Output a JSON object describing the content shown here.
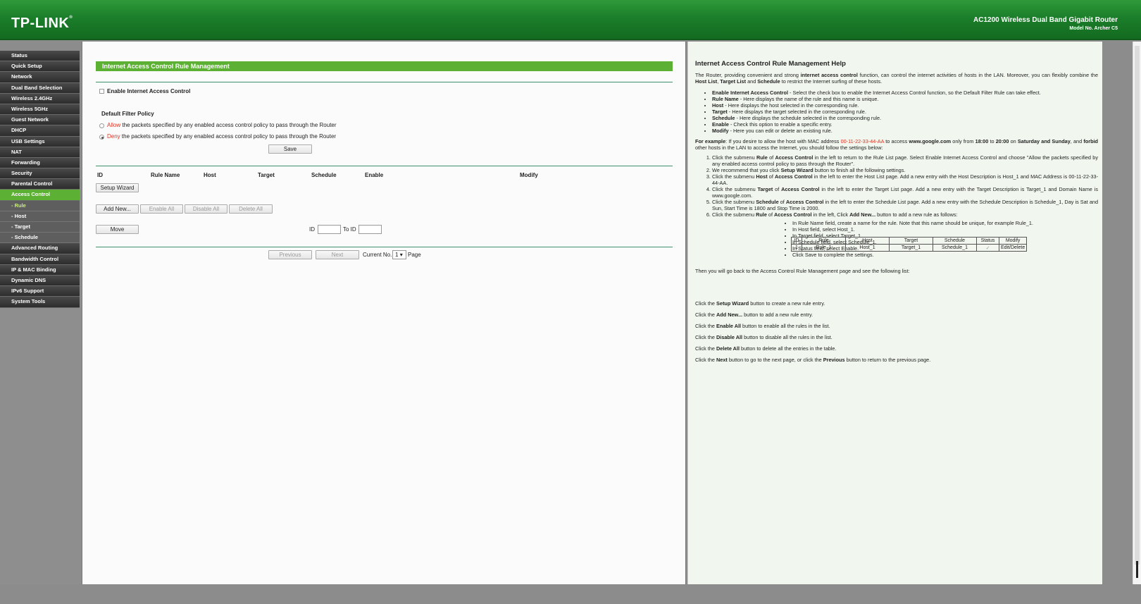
{
  "header": {
    "brand": "TP-LINK",
    "product_name": "AC1200 Wireless Dual Band Gigabit Router",
    "model": "Model No. Archer C5"
  },
  "sidebar": {
    "items": [
      {
        "label": "Status",
        "type": "item"
      },
      {
        "label": "Quick Setup",
        "type": "item"
      },
      {
        "label": "Network",
        "type": "item"
      },
      {
        "label": "Dual Band Selection",
        "type": "item"
      },
      {
        "label": "Wireless 2.4GHz",
        "type": "item"
      },
      {
        "label": "Wireless 5GHz",
        "type": "item"
      },
      {
        "label": "Guest Network",
        "type": "item"
      },
      {
        "label": "DHCP",
        "type": "item"
      },
      {
        "label": "USB Settings",
        "type": "item"
      },
      {
        "label": "NAT",
        "type": "item"
      },
      {
        "label": "Forwarding",
        "type": "item"
      },
      {
        "label": "Security",
        "type": "item"
      },
      {
        "label": "Parental Control",
        "type": "item"
      },
      {
        "label": "Access Control",
        "type": "item",
        "active": true
      },
      {
        "label": "- Rule",
        "type": "sub",
        "active": true
      },
      {
        "label": "- Host",
        "type": "sub"
      },
      {
        "label": "- Target",
        "type": "sub"
      },
      {
        "label": "- Schedule",
        "type": "sub"
      },
      {
        "label": "Advanced Routing",
        "type": "item"
      },
      {
        "label": "Bandwidth Control",
        "type": "item"
      },
      {
        "label": "IP & MAC Binding",
        "type": "item"
      },
      {
        "label": "Dynamic DNS",
        "type": "item"
      },
      {
        "label": "IPv6 Support",
        "type": "item"
      },
      {
        "label": "System Tools",
        "type": "item"
      }
    ]
  },
  "main": {
    "title": "Internet Access Control Rule Management",
    "enable_label": "Enable Internet Access Control",
    "policy_title": "Default Filter Policy",
    "allow_word": "Allow",
    "allow_rest": " the packets specified by any enabled access control policy to pass through the Router",
    "deny_word": "Deny",
    "deny_rest": " the packets specified by any enabled access control policy to pass through the Router",
    "save_label": "Save",
    "columns": [
      "ID",
      "Rule Name",
      "Host",
      "Target",
      "Schedule",
      "Enable",
      "Modify"
    ],
    "setup_wizard_label": "Setup Wizard",
    "add_new_label": "Add New...",
    "enable_all_label": "Enable All",
    "disable_all_label": "Disable All",
    "delete_all_label": "Delete All",
    "move_label": "Move",
    "id_label": "ID",
    "to_id_label": "To ID",
    "previous_label": "Previous",
    "next_label": "Next",
    "current_no_label": "Current No.",
    "current_page": "1",
    "page_label": "Page"
  },
  "help": {
    "title": "Internet Access Control Rule Management Help",
    "intro": {
      "a": "The Router, providing convenient and strong ",
      "b": "internet access control",
      "c": " function, can control the internet activities of hosts in the LAN. Moreover, you can flexibly combine the ",
      "d": "Host List",
      "e": ", ",
      "f": "Target List",
      "g": " and ",
      "h": "Schedule",
      "i": " to restrict the Internet surfing of these hosts."
    },
    "bullets": [
      {
        "term": "Enable Internet Access Control",
        "desc": " - Select the check box to enable the Internet Access Control function, so the Default Filter Rule can take effect."
      },
      {
        "term": "Rule Name",
        "desc": " - Here displays the name of the rule and this name is unique."
      },
      {
        "term": "Host",
        "desc": " - Here displays the host selected in the corresponding rule."
      },
      {
        "term": "Target",
        "desc": " - Here displays the target selected in the corresponding rule."
      },
      {
        "term": "Schedule",
        "desc": " - Here displays the schedule selected in the corresponding rule."
      },
      {
        "term": "Enable",
        "desc": " - Check this option to enable a specific entry."
      },
      {
        "term": "Modify",
        "desc": " - Here you can edit or delete an existing rule."
      }
    ],
    "example": {
      "lead": "For example",
      "a": ": If you desire to allow the host with MAC address ",
      "mac": "00-11-22-33-44-AA",
      "b": " to access ",
      "site": "www.google.com",
      "c": " only from ",
      "t1": "18:00",
      "d": " to ",
      "t2": "20:00",
      "e": " on ",
      "days": "Saturday and Sunday",
      "f": ", and ",
      "forbid": "forbid",
      "g": " other hosts in the LAN to access the Internet, you should follow the settings below:"
    },
    "steps": [
      "Click the submenu <b>Rule</b> of <b>Access Control</b> in the left to return to the Rule List page. Select Enable Internet Access Control and choose \"Allow the packets specified by any enabled access control policy to pass through the Router\".",
      "We recommend that you click <b>Setup Wizard</b> button to finish all the following settings.",
      "Click the submenu <b>Host</b> of <b>Access Control</b> in the left to enter the Host List page. Add a new entry with the Host Description is Host_1 and MAC Address is 00-11-22-33-44-AA.",
      "Click the submenu <b>Target</b> of <b>Access Control</b> in the left to enter the Target List page. Add a new entry with the Target Description is Target_1 and Domain Name is www.google.com.",
      "Click the submenu <b>Schedule</b> of <b>Access Control</b> in the left to enter the Schedule List page. Add a new entry with the Schedule Description is Schedule_1, Day is Sat and Sun, Start Time is 1800 and Stop Time is 2000.",
      "Click the submenu <b>Rule</b> of <b>Access Control</b> in the left, Click <b>Add New...</b> button to add a new rule as follows:"
    ],
    "sub_steps": [
      "In Rule Name field, create a name for the rule. Note that this name should be unique, for example Rule_1.",
      "In Host field, select Host_1.",
      "In Target field, select Target_1.",
      "In Schedule field, select Schedule_1.",
      "In Status field, select Enable.",
      "Click Save to complete the settings."
    ],
    "then_text": "Then you will go back to the Access Control Rule Management page and see the following list:",
    "table": {
      "headers": [
        "ID",
        "Rule",
        "Host",
        "Target",
        "Schedule",
        "Status",
        "Modify"
      ],
      "row": [
        "1",
        "Rule_1",
        "Host_1",
        "Target_1",
        "Schedule_1",
        "✓",
        "Edit/Delete"
      ]
    },
    "tips": [
      {
        "a": "Click the ",
        "b": "Setup Wizard",
        "c": " button to create a new rule entry."
      },
      {
        "a": "Click the ",
        "b": "Add New...",
        "c": " button to add a new rule entry."
      },
      {
        "a": "Click the ",
        "b": "Enable All",
        "c": " button to enable all the rules in the list."
      },
      {
        "a": "Click the ",
        "b": "Disable All",
        "c": " button to disable all the rules in the list."
      },
      {
        "a": "Click the ",
        "b": "Delete All",
        "c": " button to delete all the entries in the table."
      }
    ],
    "last_tip": {
      "a": "Click the ",
      "b": "Next",
      "c": " button to go to the next page, or click the ",
      "d": "Previous",
      "e": " button to return to the previous page."
    }
  },
  "colors": {
    "accent_green": "#5cb134",
    "header_green": "#1b7e2a",
    "red_text": "#e0301e"
  }
}
